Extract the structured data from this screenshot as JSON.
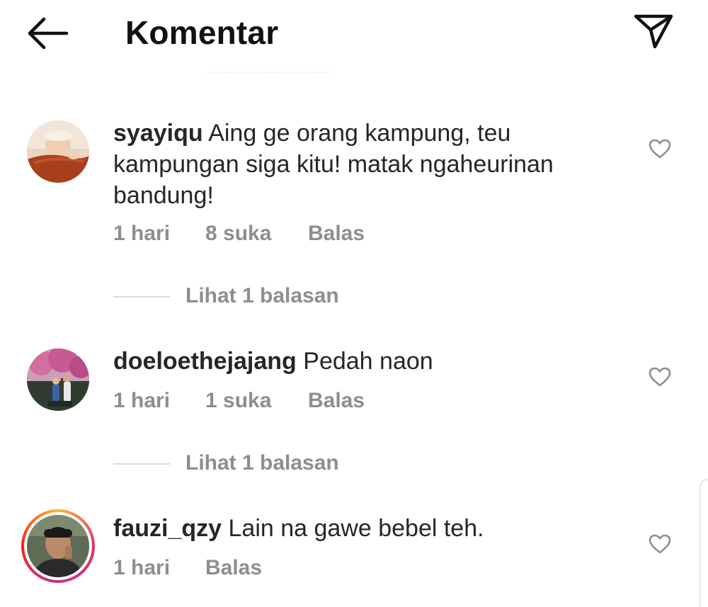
{
  "header": {
    "title": "Komentar",
    "back_icon": "arrow-left-icon",
    "share_icon": "paper-plane-icon"
  },
  "comments": [
    {
      "username": "syayiqu",
      "text": "Aing ge orang kampung, teu kampungan siga kitu! matak ngaheurinan bandung!",
      "time": "1 hari",
      "likes": "8 suka",
      "reply": "Balas",
      "view_replies": "Lihat 1 balasan",
      "has_story_ring": false
    },
    {
      "username": "doeloethejajang",
      "text": "Pedah naon",
      "time": "1 hari",
      "likes": "1 suka",
      "reply": "Balas",
      "view_replies": "Lihat 1 balasan",
      "has_story_ring": false
    },
    {
      "username": "fauzi_qzy",
      "text": "Lain na gawe bebel teh.",
      "time": "1 hari",
      "reply": "Balas",
      "has_story_ring": true
    }
  ],
  "colors": {
    "text": "#262626",
    "secondary": "#8e8e8e",
    "divider": "#dbdbdb",
    "story_ring": [
      "#f7b733",
      "#e1306c",
      "#c13584"
    ]
  }
}
